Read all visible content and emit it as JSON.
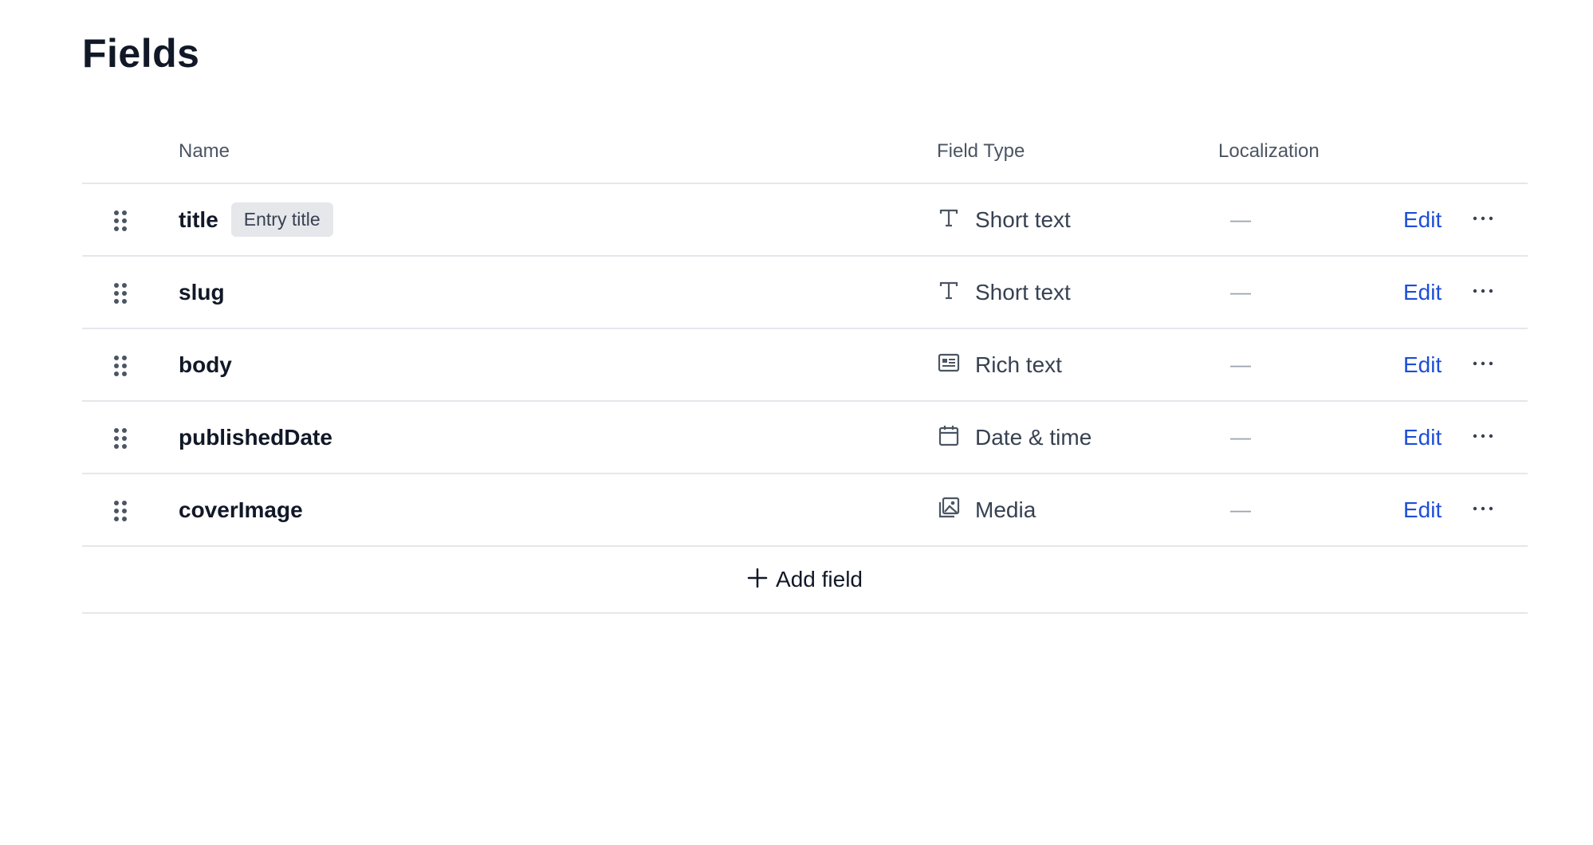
{
  "page": {
    "title": "Fields"
  },
  "table": {
    "headers": {
      "name": "Name",
      "field_type": "Field Type",
      "localization": "Localization"
    },
    "rows": [
      {
        "name": "title",
        "badge": "Entry title",
        "type_label": "Short text",
        "type_icon": "text-t-icon",
        "localization": "—",
        "edit_label": "Edit",
        "more_label": "···"
      },
      {
        "name": "slug",
        "badge": "",
        "type_label": "Short text",
        "type_icon": "text-t-icon",
        "localization": "—",
        "edit_label": "Edit",
        "more_label": "···"
      },
      {
        "name": "body",
        "badge": "",
        "type_label": "Rich text",
        "type_icon": "rich-text-icon",
        "localization": "—",
        "edit_label": "Edit",
        "more_label": "···"
      },
      {
        "name": "publishedDate",
        "badge": "",
        "type_label": "Date & time",
        "type_icon": "calendar-icon",
        "localization": "—",
        "edit_label": "Edit",
        "more_label": "···"
      },
      {
        "name": "coverImage",
        "badge": "",
        "type_label": "Media",
        "type_icon": "media-icon",
        "localization": "—",
        "edit_label": "Edit",
        "more_label": "···"
      }
    ],
    "add_field_label": "Add field"
  },
  "colors": {
    "edit_link": "#1d4ed8",
    "border": "#e5e7eb",
    "badge_bg": "#e5e7eb",
    "muted_text": "#4b5563"
  }
}
